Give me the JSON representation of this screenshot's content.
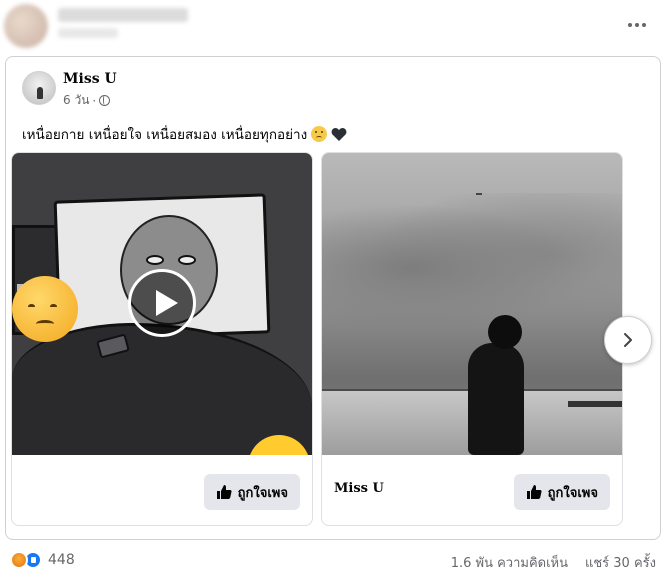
{
  "outer": {
    "menu_icon": "more-horizontal-icon"
  },
  "post": {
    "page_name": "Miss U",
    "time": "6 วัน",
    "audience_icon": "globe-icon",
    "text": "เหนื่อยกาย เหนื่อยใจ เหนื่อยสมอง เหนื่อยทุกอย่าง"
  },
  "carousel": {
    "tiles": [
      {
        "media": "video-thumbnail",
        "name": "",
        "button_label": "ถูกใจเพจ",
        "button_icon": "thumbs-up-icon"
      },
      {
        "media": "photo",
        "name": "Miss U",
        "button_label": "ถูกใจเพจ",
        "button_icon": "thumbs-up-icon"
      }
    ],
    "next_icon": "chevron-right-icon"
  },
  "footer": {
    "reaction_count": "448",
    "comments": "1.6 พัน ความคิดเห็น",
    "shares": "แชร์ 30 ครั้ง"
  },
  "colors": {
    "brand_blue": "#1877f2",
    "muted_text": "#65676b",
    "button_bg": "#e4e6eb"
  }
}
